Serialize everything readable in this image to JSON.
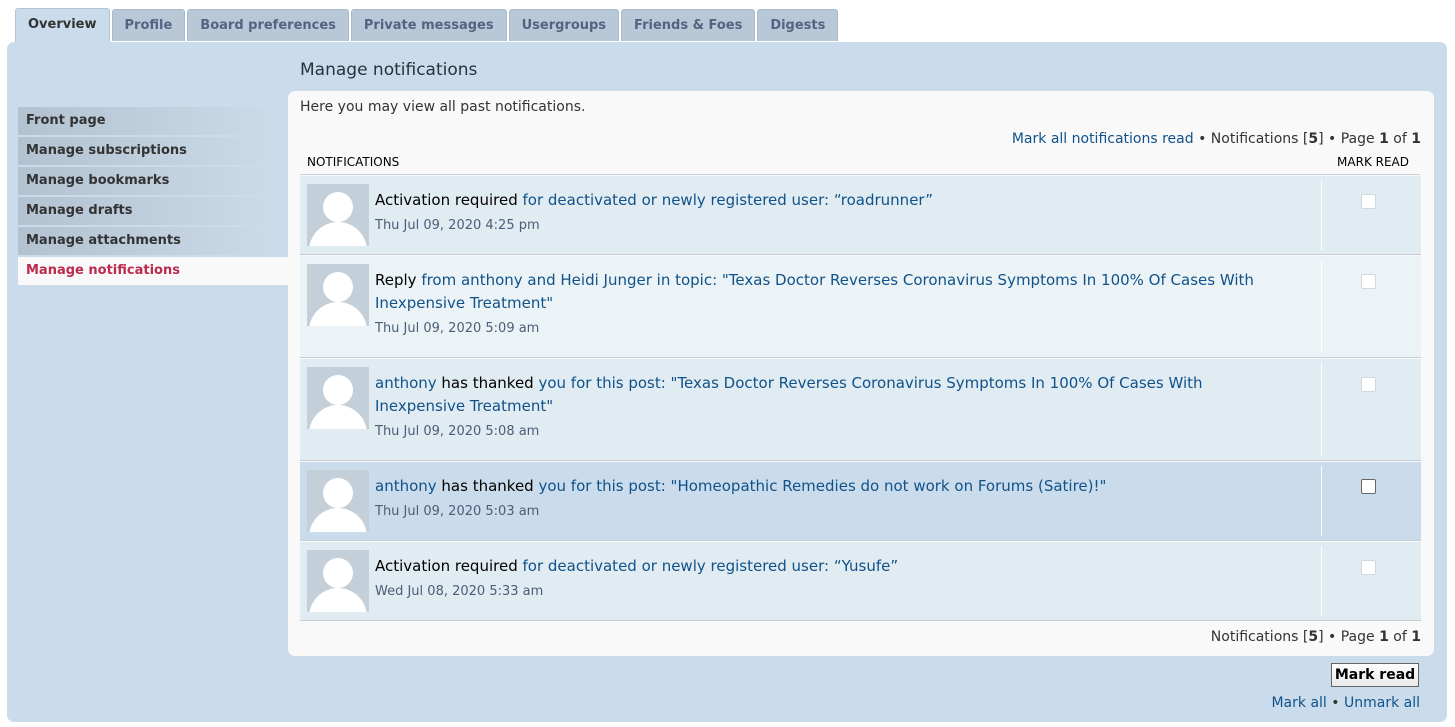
{
  "tabs": [
    {
      "label": "Overview",
      "active": true
    },
    {
      "label": "Profile"
    },
    {
      "label": "Board preferences"
    },
    {
      "label": "Private messages"
    },
    {
      "label": "Usergroups"
    },
    {
      "label": "Friends & Foes"
    },
    {
      "label": "Digests"
    }
  ],
  "sidebar": {
    "items": [
      {
        "label": "Front page"
      },
      {
        "label": "Manage subscriptions"
      },
      {
        "label": "Manage bookmarks"
      },
      {
        "label": "Manage drafts"
      },
      {
        "label": "Manage attachments"
      },
      {
        "label": "Manage notifications",
        "active": true
      }
    ]
  },
  "main": {
    "title": "Manage notifications",
    "intro": "Here you may view all past notifications.",
    "mark_all_read": "Mark all notifications read",
    "pagination": {
      "notifications_label": "Notifications",
      "count": "5",
      "page_label": "Page",
      "page": "1",
      "of_label": "of",
      "total_pages": "1"
    },
    "columns": {
      "notifications": "NOTIFICATIONS",
      "mark_read": "MARK READ"
    },
    "notifications": [
      {
        "bold": "Activation required",
        "rest": " for deactivated or newly registered user: “roadrunner”",
        "time": "Thu Jul 09, 2020 4:25 pm",
        "checked": false
      },
      {
        "bold": "Reply",
        "rest": " from anthony and Heidi Junger in topic: \"Texas Doctor Reverses Coronavirus Symptoms In 100% Of Cases With Inexpensive Treatment\"",
        "time": "Thu Jul 09, 2020 5:09 am",
        "checked": false
      },
      {
        "lead": "anthony ",
        "bold": "has thanked",
        "rest": " you for this post: \"Texas Doctor Reverses Coronavirus Symptoms In 100% Of Cases With Inexpensive Treatment\"",
        "time": "Thu Jul 09, 2020 5:08 am",
        "checked": false
      },
      {
        "lead": "anthony ",
        "bold": "has thanked",
        "rest": " you for this post: \"Homeopathic Remedies do not work on Forums (Satire)!\"",
        "time": "Thu Jul 09, 2020 5:03 am",
        "checked": false
      },
      {
        "bold": "Activation required",
        "rest": " for deactivated or newly registered user: “Yusufe”",
        "time": "Wed Jul 08, 2020 5:33 am",
        "checked": false
      }
    ],
    "mark_read_button": "Mark read",
    "mark_all": "Mark all",
    "unmark_all": "Unmark all",
    "bullet": "•"
  }
}
